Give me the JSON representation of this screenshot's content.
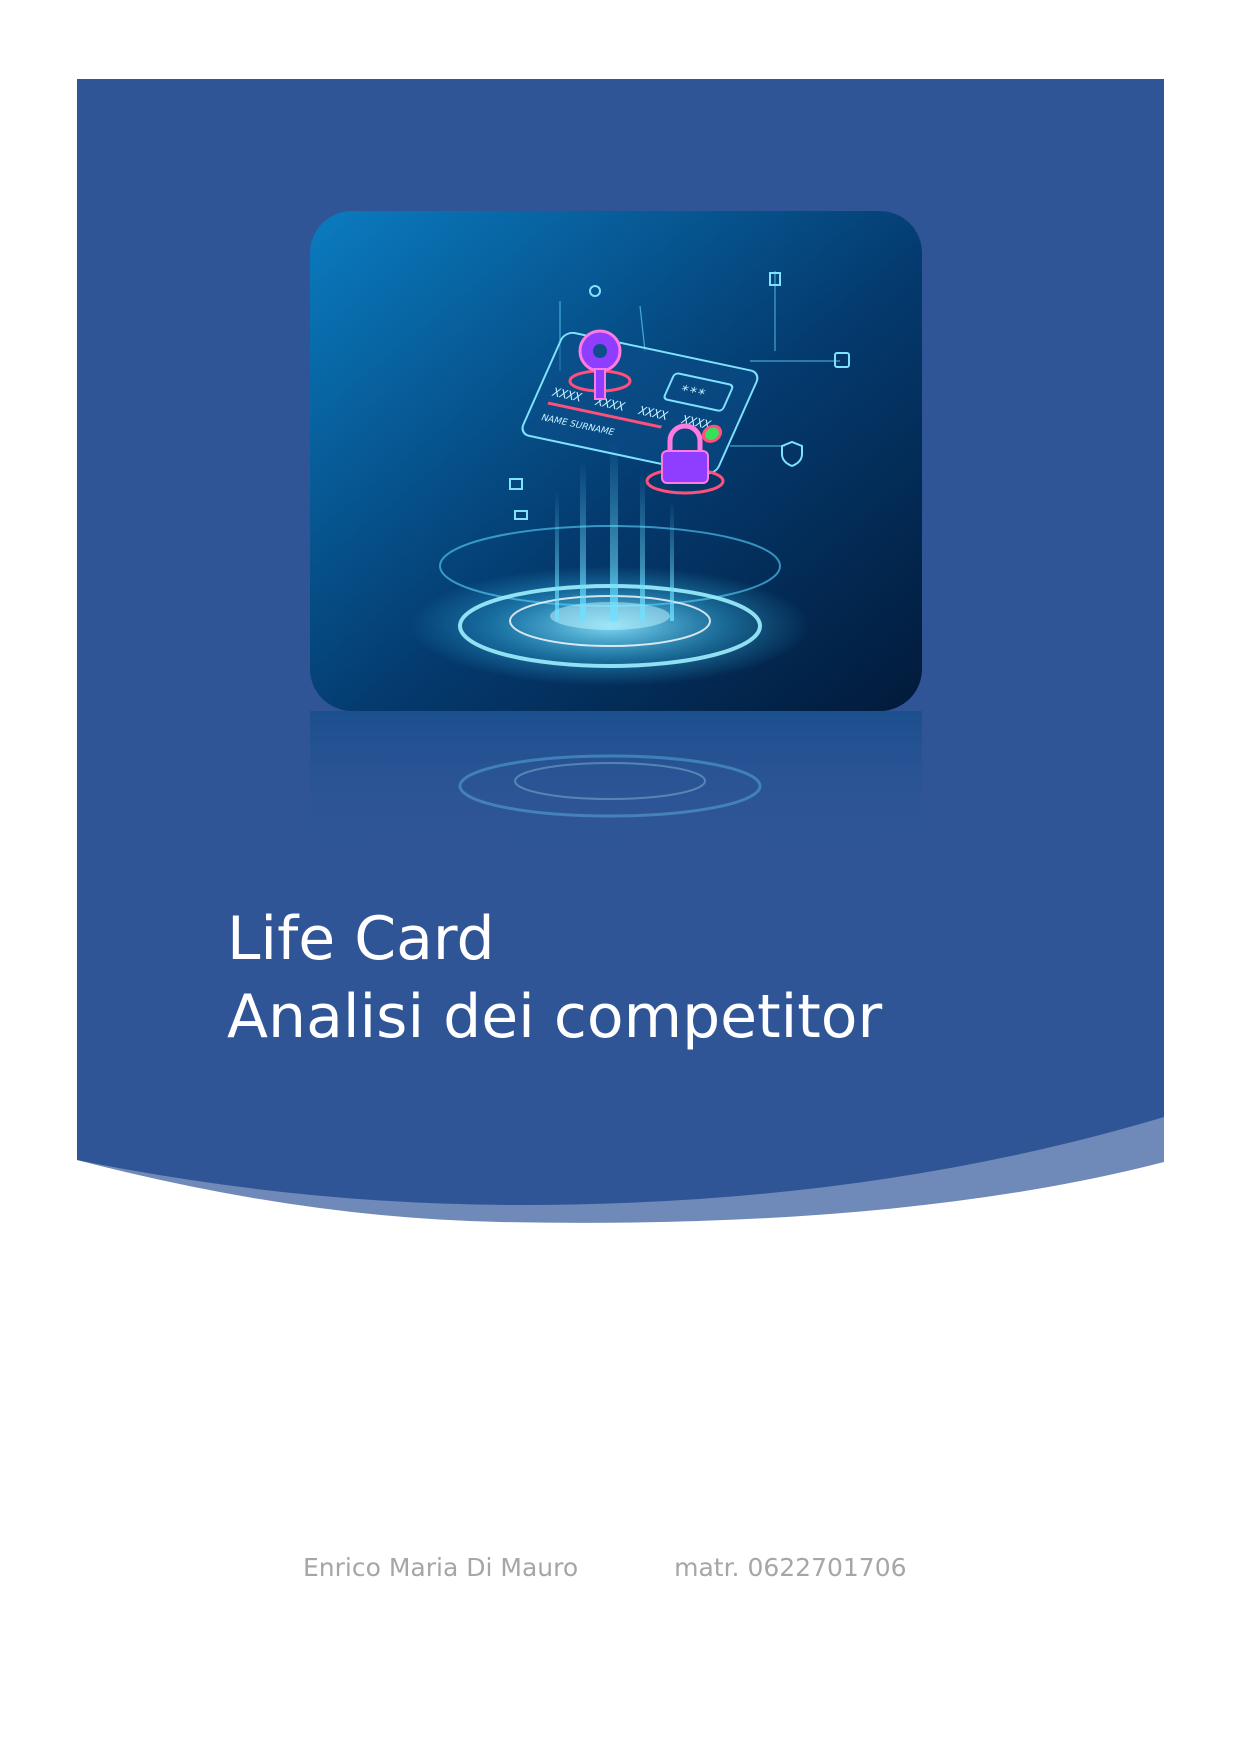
{
  "colors": {
    "band": "#2f5597",
    "band_accent": "#6f8ab8",
    "card_dark": "#021a3a",
    "card_light": "#0a7cc0",
    "glow": "#3fd0ff",
    "pink": "#ff4f7a",
    "footer_text": "#a6a6a6",
    "title_text": "#ffffff"
  },
  "cover": {
    "title_lines": [
      "Life Card",
      "Analisi dei competitor"
    ]
  },
  "hero": {
    "card_texts": [
      "XXXX",
      "XXXX",
      "XXXX",
      "XXXX",
      "NAME SURNAME",
      "***"
    ],
    "icons": [
      "key-icon",
      "lock-icon",
      "shield-icon",
      "chip-icon"
    ]
  },
  "footer": {
    "author": "Enrico Maria Di Mauro",
    "matricola": "matr. 0622701706"
  }
}
